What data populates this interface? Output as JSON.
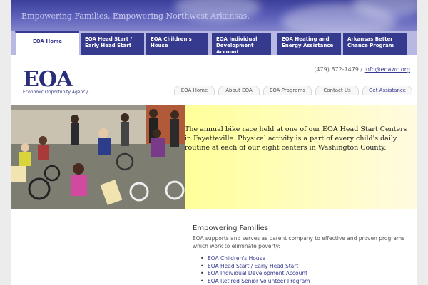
{
  "banner": {
    "tagline": "Empowering Families. Empowering Northwest Arkansas."
  },
  "tabs": [
    {
      "label": "EOA Home",
      "active": true
    },
    {
      "label": "EOA Head Start / Early Head Start",
      "active": false
    },
    {
      "label": "EOA Children's House",
      "active": false
    },
    {
      "label": "EOA Individual Development Account",
      "active": false
    },
    {
      "label": "EOA Heating and Energy Assistance",
      "active": false
    },
    {
      "label": "Arkansas Better Chance Program",
      "active": false
    }
  ],
  "logo": {
    "mark": "EOA",
    "subtitle": "Economic Opportunity Agency"
  },
  "contact": {
    "phone": "(479) 872-7479",
    "separator": "/",
    "email": "info@eoawc.org"
  },
  "subnav": [
    {
      "label": "EOA Home"
    },
    {
      "label": "About EOA"
    },
    {
      "label": "EOA Programs"
    },
    {
      "label": "Contact Us"
    },
    {
      "label": "Get Assistance"
    }
  ],
  "hero": {
    "caption": "The annual bike race held at one of our EOA Head Start Centers in Fayetteville. Physical activity is a part of every child's daily routine at each of our eight centers in Washington County."
  },
  "main": {
    "heading": "Empowering Families",
    "intro": "EOA supports and serves as parent company to effective and proven programs which work to eliminate poverty:",
    "links": [
      "EOA Children's House",
      "EOA Head Start / Early Head Start",
      "EOA Individual Development Account",
      "EOA Retired Senior Volunteer Program"
    ]
  },
  "colors": {
    "brand": "#363a8f",
    "caption_bg": "#ffff99"
  }
}
